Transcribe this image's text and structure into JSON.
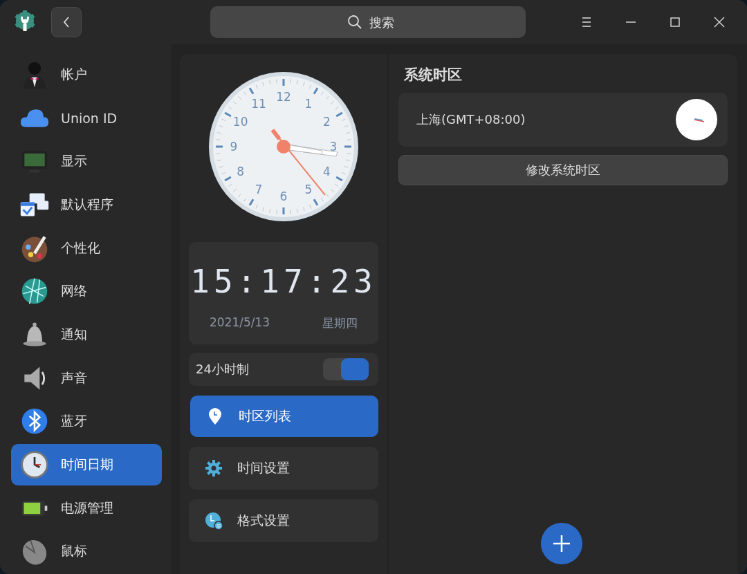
{
  "titlebar": {
    "search": {
      "placeholder": "搜索"
    }
  },
  "sidebar": {
    "items": [
      {
        "label": "帐户",
        "selected": false
      },
      {
        "label": "Union ID",
        "selected": false
      },
      {
        "label": "显示",
        "selected": false
      },
      {
        "label": "默认程序",
        "selected": false
      },
      {
        "label": "个性化",
        "selected": false
      },
      {
        "label": "网络",
        "selected": false
      },
      {
        "label": "通知",
        "selected": false
      },
      {
        "label": "声音",
        "selected": false
      },
      {
        "label": "蓝牙",
        "selected": false
      },
      {
        "label": "时间日期",
        "selected": true
      },
      {
        "label": "电源管理",
        "selected": false
      },
      {
        "label": "鼠标",
        "selected": false
      }
    ]
  },
  "clock": {
    "numbers": [
      "12",
      "1",
      "2",
      "3",
      "4",
      "5",
      "6",
      "7",
      "8",
      "9",
      "10",
      "11"
    ]
  },
  "digital": {
    "time": "15:17:23",
    "date": "2021/5/13",
    "weekday": "星期四"
  },
  "hour_format": {
    "label": "24小时制",
    "on": true
  },
  "nav": [
    {
      "label": "时区列表",
      "selected": true
    },
    {
      "label": "时间设置",
      "selected": false
    },
    {
      "label": "格式设置",
      "selected": false
    }
  ],
  "system_timezone": {
    "title": "系统时区",
    "zone": "上海(GMT+08:00)",
    "button": "修改系统时区"
  }
}
